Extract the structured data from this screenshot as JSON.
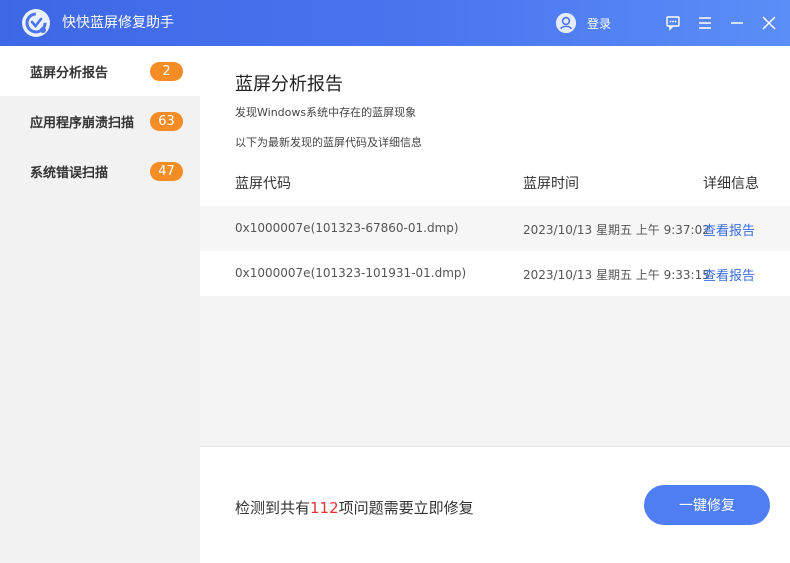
{
  "window": {
    "title": "快快蓝屏修复助手",
    "accent": "#4a75ef"
  },
  "header": {
    "login_label": "登录"
  },
  "sidebar": {
    "items": [
      {
        "label": "蓝屏分析报告",
        "badge": "2",
        "active": true
      },
      {
        "label": "应用程序崩溃扫描",
        "badge": "63",
        "active": false
      },
      {
        "label": "系统错误扫描",
        "badge": "47",
        "active": false
      }
    ],
    "badge_color": "#f68c25"
  },
  "main": {
    "title": "蓝屏分析报告",
    "desc1": "发现Windows系统中存在的蓝屏现象",
    "desc2": "以下为最新发现的蓝屏代码及详细信息",
    "columns": {
      "code": "蓝屏代码",
      "time": "蓝屏时间",
      "detail": "详细信息"
    },
    "rows": [
      {
        "code": "0x1000007e(101323-67860-01.dmp)",
        "time": "2023/10/13 星期五 上午 9:37:02",
        "link": "查看报告"
      },
      {
        "code": "0x1000007e(101323-101931-01.dmp)",
        "time": "2023/10/13 星期五 上午 9:33:15",
        "link": "查看报告"
      }
    ]
  },
  "footer": {
    "summary_prefix": "检测到共有",
    "summary_count": "112",
    "summary_suffix": "项问题需要立即修复",
    "fix_button": "一键修复",
    "count_color": "#e03333"
  },
  "icons": {
    "logo": "app-logo-icon",
    "user": "user-icon",
    "feedback": "feedback-icon",
    "menu": "menu-icon",
    "minimize": "minimize-icon",
    "close": "close-icon"
  }
}
